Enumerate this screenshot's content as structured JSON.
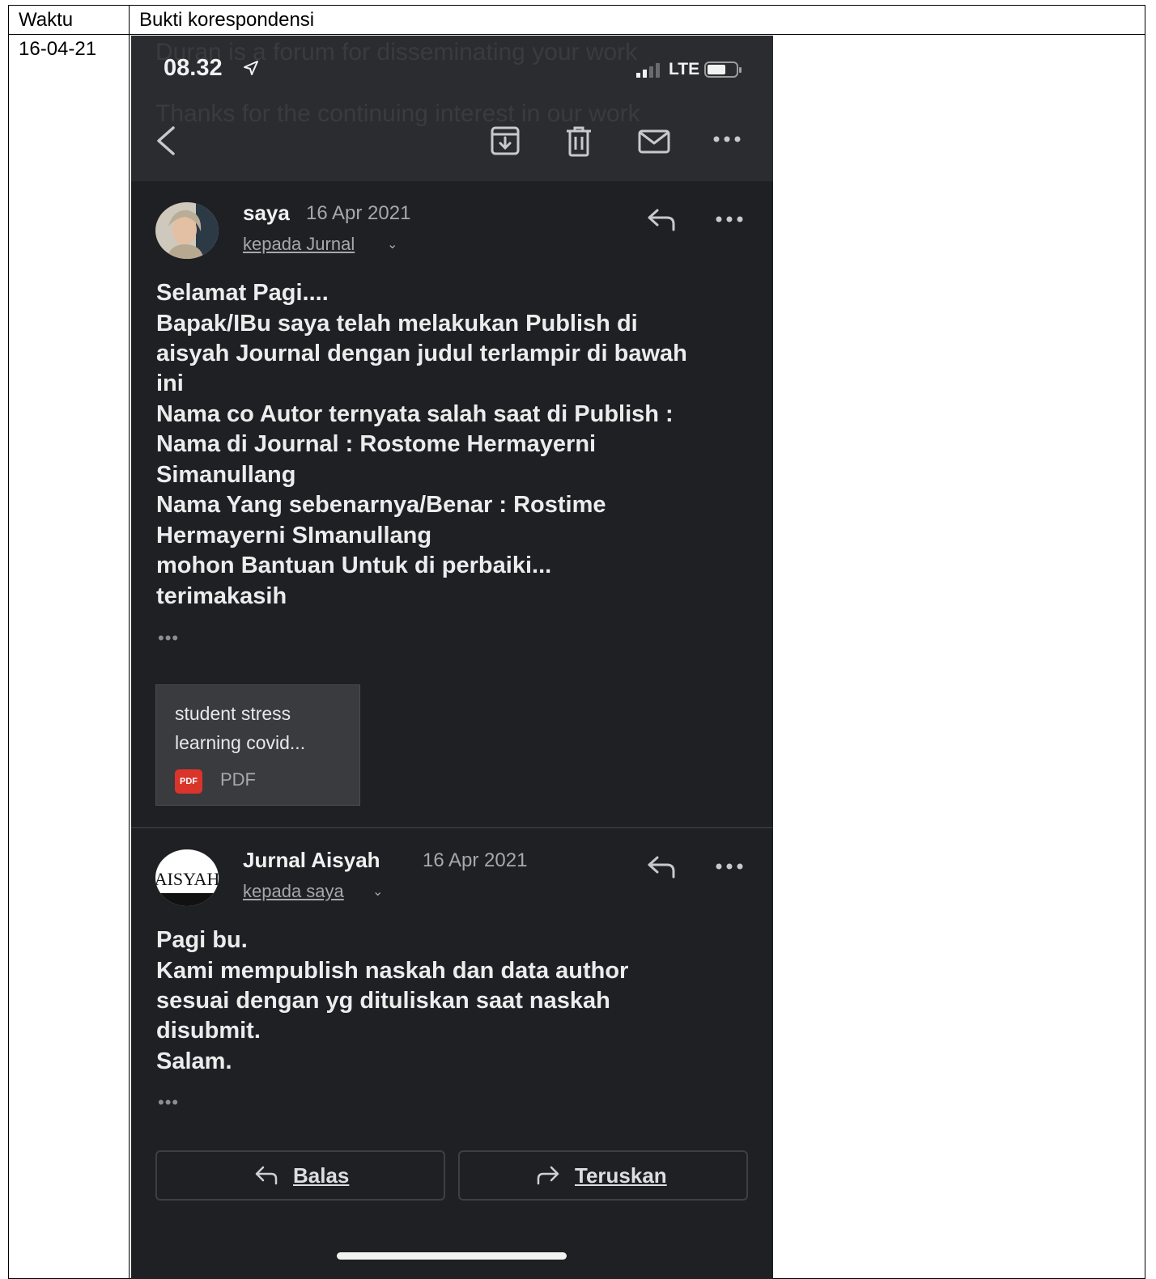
{
  "table": {
    "header_time": "Waktu",
    "header_evidence": "Bukti korespondensi",
    "row_date": "16-04-21"
  },
  "phone": {
    "status_time": "08.32",
    "network": "LTE",
    "ghost_lines": [
      "Duran is a forum for disseminating your work",
      "Thanks for the continuing interest in our work"
    ]
  },
  "messages": [
    {
      "sender": "saya",
      "date": "16 Apr 2021",
      "to": "kepada Jurnal",
      "body": [
        "Selamat Pagi....",
        "Bapak/IBu saya telah melakukan Publish di",
        "aisyah Journal dengan judul terlampir di bawah",
        "ini",
        "Nama co Autor ternyata salah saat di Publish :",
        "Nama di Journal : Rostome Hermayerni",
        "Simanullang",
        "Nama Yang sebenarnya/Benar : Rostime",
        "Hermayerni SImanullang",
        "mohon Bantuan Untuk di perbaiki...",
        "terimakasih"
      ],
      "ellipsis": "•••"
    },
    {
      "sender": "Jurnal Aisyah",
      "date": "16 Apr 2021",
      "to": "kepada saya",
      "avatar_text": "AISYAH",
      "body": [
        "Pagi bu.",
        "Kami mempublish naskah dan data author",
        "sesuai dengan yg dituliskan saat naskah",
        "disubmit.",
        "Salam."
      ],
      "ellipsis": "•••"
    }
  ],
  "attachment": {
    "name_line1": "student stress",
    "name_line2": "learning covid...",
    "badge": "PDF",
    "type": "PDF"
  },
  "actions": {
    "reply": "Balas",
    "forward": "Teruskan"
  },
  "colors": {
    "app_background": "#1f2023",
    "toolbar": "#2b2c2f",
    "pdf_badge": "#d9352b"
  }
}
